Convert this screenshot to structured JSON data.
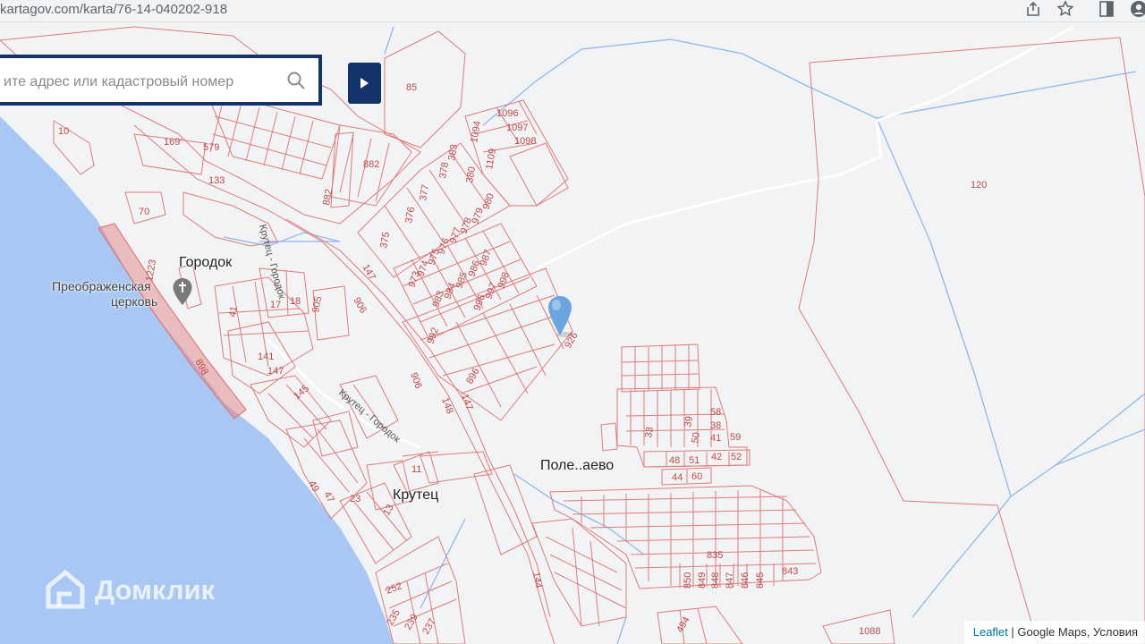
{
  "browser": {
    "url": "kartagov.com/karta/76-14-040202-918",
    "icons": [
      "share-icon",
      "star-icon",
      "sidebar-icon",
      "profile-icon"
    ]
  },
  "search": {
    "placeholder": "ите адрес или кадастровый номер",
    "icon": "search-icon",
    "submit_icon": "play-icon"
  },
  "places": {
    "gorodok": "Городок",
    "church_line1": "Преображенская",
    "church_line2": "церковь",
    "krutets": "Крутец",
    "polenaevo": "Поле..аево"
  },
  "roads": {
    "road1": "Крутец - Городок",
    "road2": "Крутец - Городок"
  },
  "parcels": {
    "p85": "85",
    "p120": "120",
    "p1096": "1096",
    "p1097": "1097",
    "p1098": "1098",
    "p1094": "1094",
    "p1109": "1109",
    "p383": "383",
    "p378": "378",
    "p380": "380",
    "p377": "377",
    "p376": "376",
    "p375": "375",
    "p882a": "882",
    "p882b": "882",
    "p579": "579",
    "p169": "169'",
    "p133": "133",
    "p10": "10",
    "p70": "70",
    "p1223": "1223",
    "p41": "41",
    "p17": "17",
    "p18": "18",
    "p905": "905",
    "p906a": "906",
    "p147a": "147",
    "p141": "141",
    "p147b": "147",
    "p145": "145",
    "p898": "898",
    "p906b": "906",
    "p148": "148",
    "p147c": "147",
    "p896": "896",
    "p926": "926",
    "p992": "992",
    "p973": "973",
    "p974": "974",
    "p975": "975",
    "p976": "976",
    "p977": "977",
    "p978": "978",
    "p979": "979",
    "p980": "980",
    "p983": "983",
    "p984": "984",
    "p985": "985",
    "p986": "986",
    "p987": "987",
    "p996": "996",
    "p997": "997",
    "p998": "998",
    "p58": "58",
    "p38": "38",
    "p39": "39",
    "p50": "50",
    "p41b": "41",
    "p59": "59",
    "p33": "33",
    "p48": "48",
    "p51": "51",
    "p42": "42",
    "p52": "52",
    "p44": "44",
    "p60": "60",
    "p835": "835",
    "p850": "850",
    "p849": "849",
    "p848": "848",
    "p847": "847",
    "p846": "846",
    "p845": "845",
    "p843": "843",
    "p144": "144",
    "p11": "11",
    "p49": "49",
    "p47": "47",
    "p23": "23",
    "p13": "13",
    "p252": "252",
    "p235": "235",
    "p239": "239",
    "p237": "237",
    "p494": "494",
    "p1088": "1088"
  },
  "watermark": "Домклик",
  "attribution": {
    "leaflet": "Leaflet",
    "separator": " | ",
    "google": "Google Maps",
    "terms": ", Условия"
  },
  "colors": {
    "water": "#a9c7f3",
    "parcel_line": "#e07a7a",
    "road_blue": "#8fb8ec",
    "search_border": "#14336b",
    "marker": "#6aa5dd"
  }
}
